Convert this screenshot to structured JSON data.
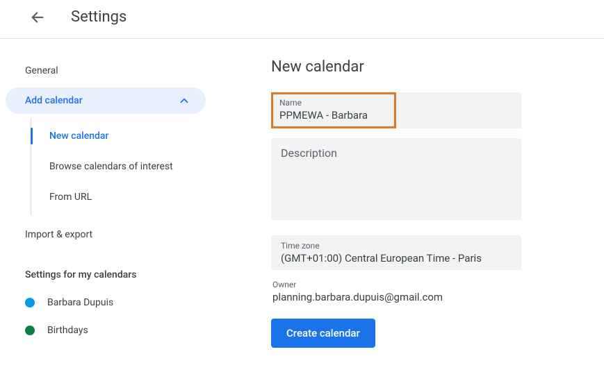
{
  "header": {
    "title": "Settings"
  },
  "sidebar": {
    "general": "General",
    "add_calendar": {
      "label": "Add calendar",
      "expanded": true,
      "items": [
        {
          "label": "New calendar",
          "active": true
        },
        {
          "label": "Browse calendars of interest",
          "active": false
        },
        {
          "label": "From URL",
          "active": false
        }
      ]
    },
    "import_export": "Import & export",
    "my_calendars_heading": "Settings for my calendars",
    "my_calendars": [
      {
        "label": "Barbara Dupuis",
        "color": "#039be5"
      },
      {
        "label": "Birthdays",
        "color": "#0b8043"
      }
    ]
  },
  "main": {
    "heading": "New calendar",
    "name_label": "Name",
    "name_value": "PPMEWA - Barbara",
    "description_placeholder": "Description",
    "description_value": "",
    "timezone_label": "Time zone",
    "timezone_value": "(GMT+01:00) Central European Time - Paris",
    "owner_label": "Owner",
    "owner_value": "planning.barbara.dupuis@gmail.com",
    "create_button": "Create calendar"
  }
}
